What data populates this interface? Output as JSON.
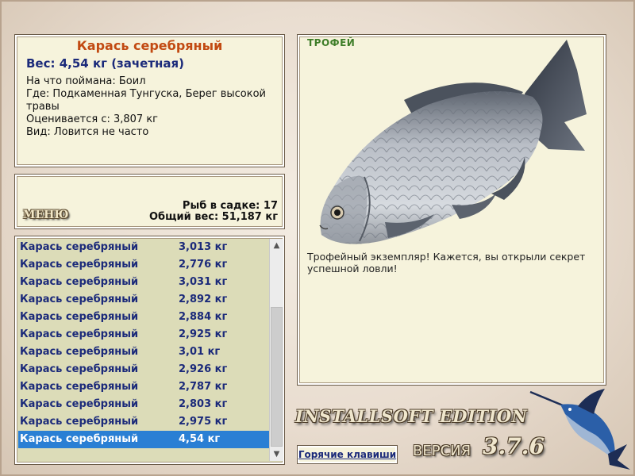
{
  "info": {
    "title": "Карась серебряный",
    "weight": "Вес: 4,54 кг (зачетная)",
    "bait": "На что поймана: Боил",
    "location": "Где: Подкаменная Тунгуска, Берег высокой травы",
    "value": "Оценивается с: 3,807 кг",
    "kind": "Вид: Ловится не часто"
  },
  "stats": {
    "menu_label": "МЕНЮ",
    "fish_in_keepnet": "Рыб в садке: 17",
    "total_weight": "Общий вес: 51,187 кг"
  },
  "catch_list": {
    "rows": [
      {
        "name": "Карась серебряный",
        "weight": "3,013 кг"
      },
      {
        "name": "Карась серебряный",
        "weight": "2,776 кг"
      },
      {
        "name": "Карась серебряный",
        "weight": "3,031 кг"
      },
      {
        "name": "Карась серебряный",
        "weight": "2,892 кг"
      },
      {
        "name": "Карась серебряный",
        "weight": "2,884 кг"
      },
      {
        "name": "Карась серебряный",
        "weight": "2,925 кг"
      },
      {
        "name": "Карась серебряный",
        "weight": "3,01 кг"
      },
      {
        "name": "Карась серебряный",
        "weight": "2,926 кг"
      },
      {
        "name": "Карась серебряный",
        "weight": "2,787 кг"
      },
      {
        "name": "Карась серебряный",
        "weight": "2,803 кг"
      },
      {
        "name": "Карась серебряный",
        "weight": "2,975 кг"
      },
      {
        "name": "Карась серебряный",
        "weight": "4,54 кг"
      }
    ],
    "selected_index": 11
  },
  "trophy": {
    "label": "ТРОФЕЙ",
    "text": "Трофейный экземпляр! Кажется, вы открыли секрет успешной ловли!"
  },
  "footer": {
    "edition": "INSTALLSOFT EDITION",
    "version_word": "ВЕРСИЯ",
    "version_number": "3.7.6",
    "hotkeys_label": "Горячие клавиши"
  },
  "icons": {
    "scroll_up": "scroll-up-arrow",
    "scroll_down": "scroll-down-arrow",
    "logo": "marlin-logo"
  },
  "colors": {
    "panel_bg": "#f6f3dc",
    "list_bg": "#dcdcb8",
    "title_orange": "#c24a12",
    "text_blue": "#1b2a7a",
    "selection_blue": "#2a7fd4",
    "trophy_green": "#3e7d28"
  }
}
